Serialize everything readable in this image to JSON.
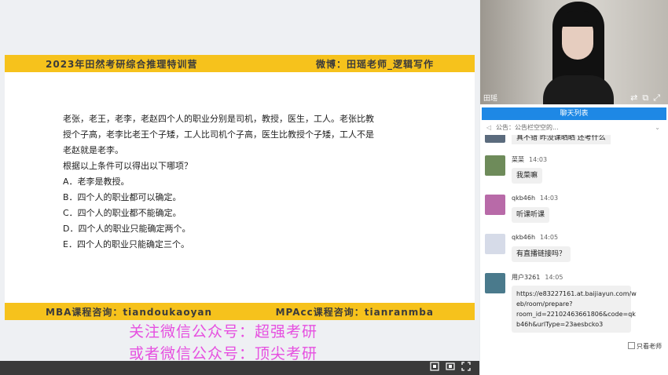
{
  "slide": {
    "top_left": "2023年田然考研综合推理特训营",
    "top_right": "微博：田瑶老师_逻辑写作",
    "question_lines": [
      "老张，老王，老李，老赵四个人的职业分别是司机，教授，医生，工人。老张比教",
      "授个子高，老李比老王个子矮，工人比司机个子高，医生比教授个子矮，工人不是",
      "老赵就是老李。",
      "根据以上条件可以得出以下哪项？",
      "A．老李是教授。",
      "B．四个人的职业都可以确定。",
      "C．四个人的职业都不能确定。",
      "D．四个人的职业只能确定两个。",
      "E．四个人的职业只能确定三个。"
    ],
    "bottom_left": "MBA课程咨询：tiandoukaoyan",
    "bottom_right": "MPAcc课程咨询：tianranmba"
  },
  "watermark": {
    "line1": "关注微信公众号：超强考研",
    "line2": "或者微信公众号：顶尖考研"
  },
  "controls": {
    "icons": [
      "screenshot-icon",
      "fullscreen-icon",
      "expand-icon"
    ]
  },
  "video": {
    "name": "田瑶"
  },
  "chat": {
    "tab": "聊天列表",
    "notice": "公告：公告栏空空的...",
    "partial": "真不错 昨没课晒晒 还考什么",
    "messages": [
      {
        "user": "菜菜",
        "time": "14:03",
        "text": "我菜嘛",
        "avatar_color": "#6e8b5a"
      },
      {
        "user": "qkb46h",
        "time": "14:03",
        "text": "听课听课",
        "avatar_color": "#b86aa8"
      },
      {
        "user": "qkb46h",
        "time": "14:05",
        "text": "有直播链接吗？",
        "avatar_color": "#d6dbe8"
      },
      {
        "user": "用户3261",
        "time": "14:05",
        "text_lines": [
          "https://e83227161.at.baijiayun.com/w",
          "eb/room/prepare?",
          "room_id=22102463661806&code=qk",
          "b46h&urlType=23aesbcko3"
        ],
        "avatar_color": "#4a7a8c"
      }
    ],
    "only_teacher": "只看老师"
  }
}
